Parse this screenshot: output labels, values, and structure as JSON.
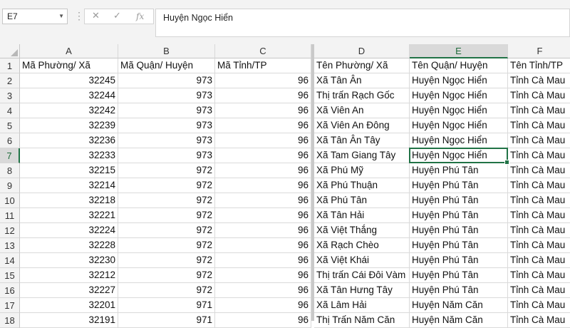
{
  "formula_bar": {
    "name_box": "E7",
    "cancel_icon": "✕",
    "enter_icon": "✓",
    "fx_label": "fx",
    "formula_value": "Huyện Ngọc Hiển"
  },
  "columns": [
    {
      "key": "A",
      "header": "Mã Phường/ Xã"
    },
    {
      "key": "B",
      "header": "Mã Quận/ Huyện"
    },
    {
      "key": "C",
      "header": "Mã Tỉnh/TP"
    },
    {
      "key": "D",
      "header": "Tên Phường/ Xã"
    },
    {
      "key": "E",
      "header": "Tên Quận/ Huyện"
    },
    {
      "key": "F",
      "header": "Tên Tỉnh/TP"
    }
  ],
  "rows": [
    [
      "32245",
      "973",
      "96",
      "Xã Tân Ân",
      "Huyện Ngọc Hiển",
      "Tỉnh Cà Mau"
    ],
    [
      "32244",
      "973",
      "96",
      "Thị trấn Rạch Gốc",
      "Huyện Ngọc Hiển",
      "Tỉnh Cà Mau"
    ],
    [
      "32242",
      "973",
      "96",
      "Xã Viên An",
      "Huyện Ngọc Hiển",
      "Tỉnh Cà Mau"
    ],
    [
      "32239",
      "973",
      "96",
      "Xã Viên An Đông",
      "Huyện Ngọc Hiển",
      "Tỉnh Cà Mau"
    ],
    [
      "32236",
      "973",
      "96",
      "Xã Tân Ân Tây",
      "Huyện Ngọc Hiển",
      "Tỉnh Cà Mau"
    ],
    [
      "32233",
      "973",
      "96",
      "Xã Tam Giang Tây",
      "Huyện Ngọc Hiển",
      "Tỉnh Cà Mau"
    ],
    [
      "32215",
      "972",
      "96",
      "Xã Phú Mỹ",
      "Huyện Phú Tân",
      "Tỉnh Cà Mau"
    ],
    [
      "32214",
      "972",
      "96",
      "Xã Phú Thuận",
      "Huyện Phú Tân",
      "Tỉnh Cà Mau"
    ],
    [
      "32218",
      "972",
      "96",
      "Xã Phú Tân",
      "Huyện Phú Tân",
      "Tỉnh Cà Mau"
    ],
    [
      "32221",
      "972",
      "96",
      "Xã Tân Hải",
      "Huyện Phú Tân",
      "Tỉnh Cà Mau"
    ],
    [
      "32224",
      "972",
      "96",
      "Xã Việt Thắng",
      "Huyện Phú Tân",
      "Tỉnh Cà Mau"
    ],
    [
      "32228",
      "972",
      "96",
      "Xã Rạch Chèo",
      "Huyện Phú Tân",
      "Tỉnh Cà Mau"
    ],
    [
      "32230",
      "972",
      "96",
      "Xã Việt Khái",
      "Huyện Phú Tân",
      "Tỉnh Cà Mau"
    ],
    [
      "32212",
      "972",
      "96",
      "Thị trấn Cái Đôi Vàm",
      "Huyện Phú Tân",
      "Tỉnh Cà Mau"
    ],
    [
      "32227",
      "972",
      "96",
      "Xã Tân Hưng Tây",
      "Huyện Phú Tân",
      "Tỉnh Cà Mau"
    ],
    [
      "32201",
      "971",
      "96",
      "Xã Lâm Hải",
      "Huyện Năm Căn",
      "Tỉnh Cà Mau"
    ],
    [
      "32191",
      "971",
      "96",
      "Thị Trấn Năm Căn",
      "Huyện Năm Căn",
      "Tỉnh Cà Mau"
    ]
  ],
  "active_cell": {
    "row": 7,
    "col": "E"
  },
  "colors": {
    "accent": "#217346"
  }
}
